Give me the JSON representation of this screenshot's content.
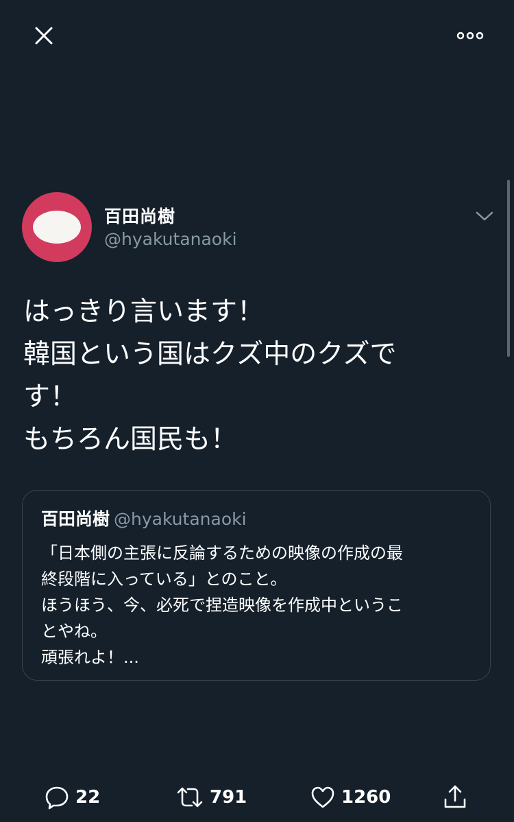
{
  "header": {
    "close_icon": "close-icon",
    "more_icon": "more-horizontal-icon"
  },
  "author": {
    "display_name": "百田尚樹",
    "handle": "@hyakutanaoki",
    "avatar_color": "#d23b5e"
  },
  "tweet": {
    "text": "はっきり言います！\n韓国という国はクズ中のクズで\nす！\nもちろん国民も！"
  },
  "quoted_tweet": {
    "display_name": "百田尚樹",
    "handle": "@hyakutanaoki",
    "text": "「日本側の主張に反論するための映像の作成の最\n終段階に入っている」とのこと。\nほうほう、今、必死で捏造映像を作成中というこ\nとやね。\n頑張れよ！..."
  },
  "actions": {
    "reply_count": "22",
    "retweet_count": "791",
    "like_count": "1260"
  },
  "colors": {
    "background": "#15202b",
    "secondary_text": "#8899a6",
    "border": "#38444d"
  }
}
